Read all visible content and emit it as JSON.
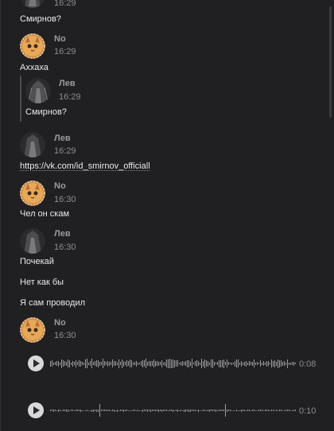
{
  "messages": [
    {
      "time": "16:29",
      "text": "Смирнов?"
    },
    {
      "author": "No",
      "time": "16:29",
      "text": "Аххаха",
      "reply": {
        "author": "Лев",
        "time": "16:29",
        "text": "Смирнов?"
      }
    },
    {
      "author": "Лев",
      "time": "16:29",
      "link": "https://vk.com/id_smirnov_officiall"
    },
    {
      "author": "No",
      "time": "16:30",
      "text": "Чел он скам"
    },
    {
      "author": "Лев",
      "time": "16:30",
      "lines": [
        "Почекай",
        "Нет как бы",
        "Я сам проводил"
      ]
    },
    {
      "author": "No",
      "time": "16:30",
      "voice": [
        {
          "duration": "0:08"
        },
        {
          "duration": "0:10"
        }
      ]
    }
  ],
  "colors": {
    "background": "#202022",
    "text": "#e9e9ea",
    "muted": "#8e8e93"
  },
  "icons": {
    "play": "play-icon",
    "avatar_no": "cat-avatar",
    "avatar_lev": "dark-figure-avatar"
  }
}
